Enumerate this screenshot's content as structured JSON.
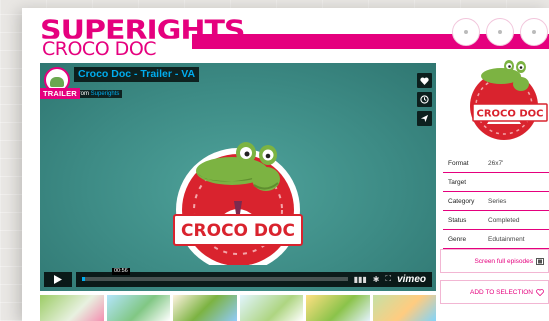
{
  "header": {
    "brand": "SUPERIGHTS",
    "title": "CROCO DOC"
  },
  "video": {
    "title": "Croco Doc - Trailer - VA",
    "from_prefix": "from",
    "from_channel": "Superights",
    "badge": "TRAILER",
    "logo_text": "CROCO DOC",
    "time_label": "00:56",
    "progress_fraction": 0.01,
    "player_brand": "vimeo"
  },
  "details": {
    "rows": [
      {
        "key": "Format",
        "value": "26x7'"
      },
      {
        "key": "Target",
        "value": ""
      },
      {
        "key": "Category",
        "value": "Series"
      },
      {
        "key": "Status",
        "value": "Completed"
      },
      {
        "key": "Genre",
        "value": "Edutainment"
      }
    ]
  },
  "poster": {
    "logo_text": "CROCO DOC"
  },
  "actions": {
    "screen_episodes": "Screen full episodes",
    "add_selection": "ADD TO SELECTION"
  },
  "colors": {
    "brand_pink": "#e5007e",
    "video_teal": "#3e8f88",
    "vimeo_blue": "#00adef"
  },
  "icons": {
    "heart": "heart-icon",
    "clock": "clock-icon",
    "send": "send-icon",
    "play": "play-icon",
    "film": "film-icon"
  }
}
